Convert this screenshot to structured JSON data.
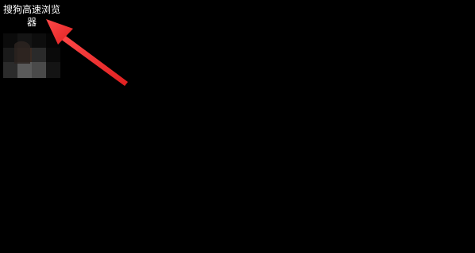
{
  "desktop": {
    "background_color": "#000000",
    "icons": [
      {
        "label": "搜狗高速浏览器",
        "icon": "sogou-browser-icon-pixelated"
      }
    ]
  },
  "annotation": {
    "arrow_color": "#ff3b3b"
  }
}
